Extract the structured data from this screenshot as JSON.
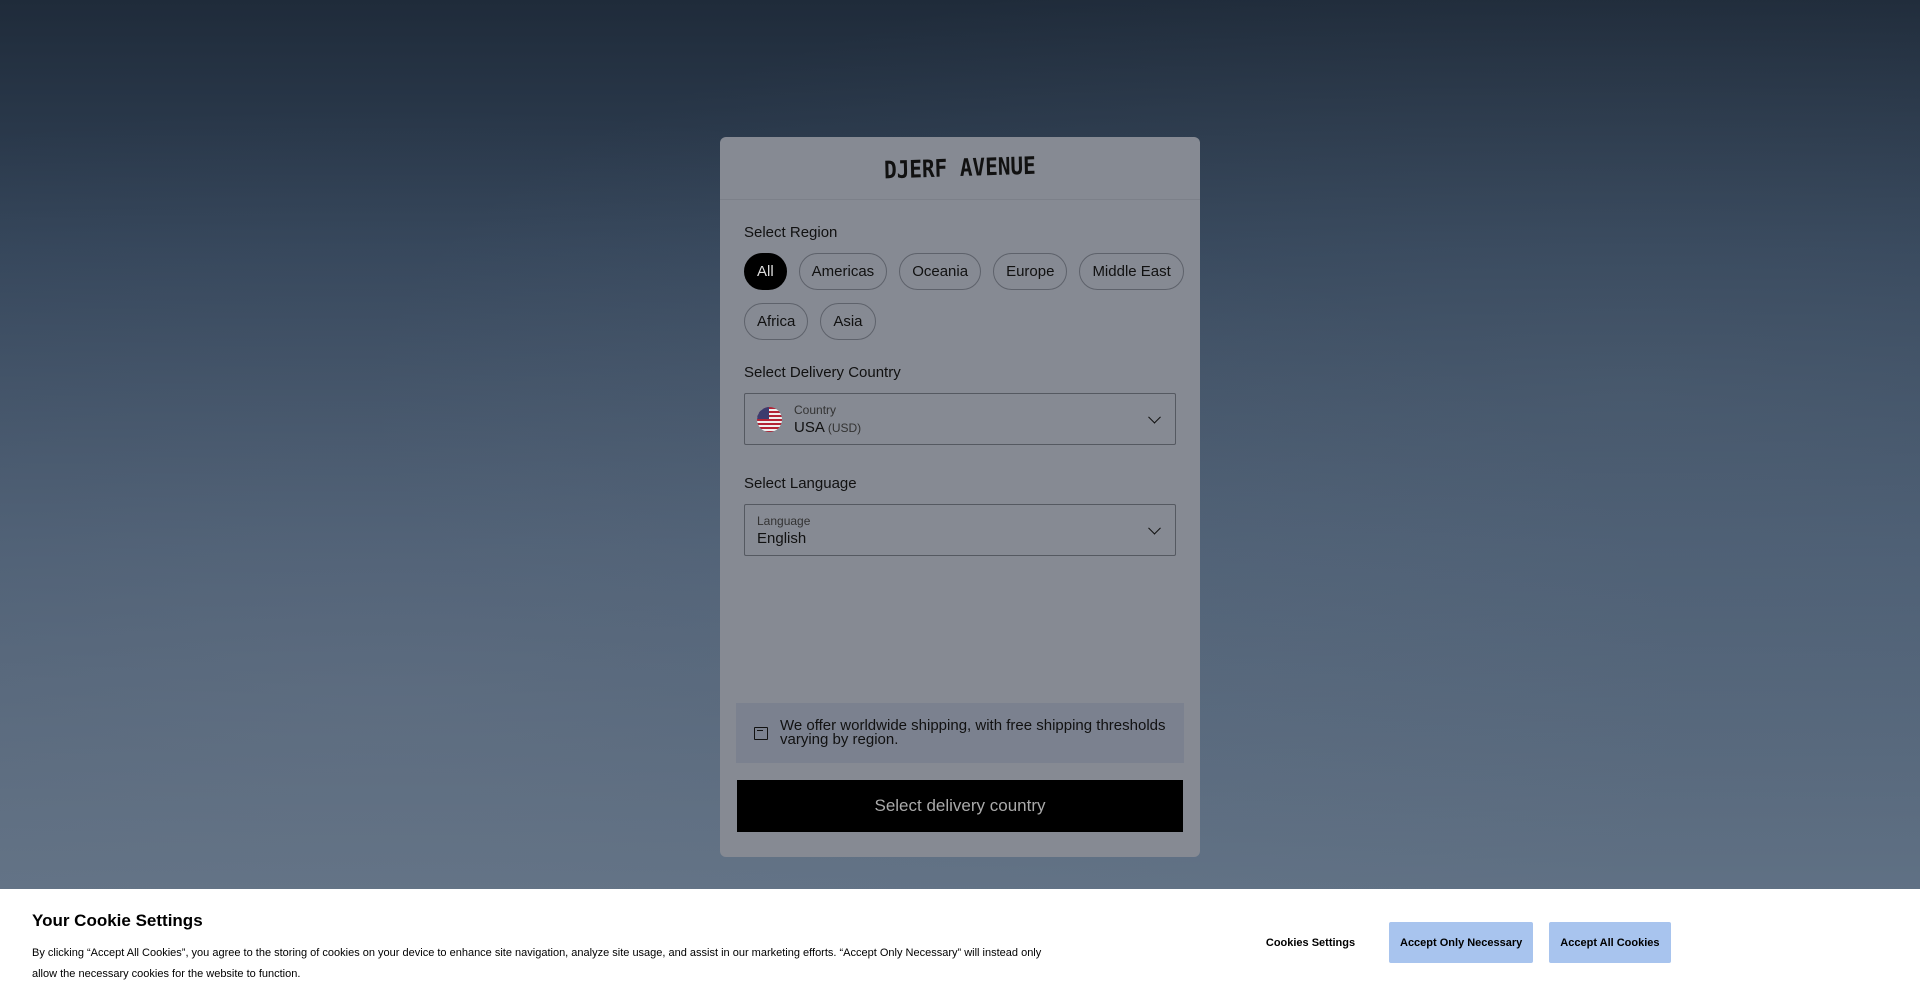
{
  "modal": {
    "logo": "DJERF AVENUE",
    "region_label": "Select Region",
    "regions": [
      "All",
      "Americas",
      "Oceania",
      "Europe",
      "Middle East",
      "Africa",
      "Asia"
    ],
    "active_region": "All",
    "country_label": "Select Delivery Country",
    "country": {
      "small_label": "Country",
      "value": "USA",
      "currency": "(USD)",
      "flag": "us-flag-icon"
    },
    "language_label": "Select Language",
    "language": {
      "small_label": "Language",
      "value": "English"
    },
    "info_text": "We offer worldwide shipping, with free shipping thresholds varying by region.",
    "cta_label": "Select delivery country"
  },
  "cookie": {
    "title": "Your Cookie Settings",
    "text": "By clicking “Accept All Cookies”, you agree to the storing of cookies on your device to enhance site navigation, analyze site usage, and assist in our marketing efforts. “Accept Only Necessary” will instead only allow the necessary cookies for the website to function.",
    "settings_label": "Cookies Settings",
    "necessary_label": "Accept Only Necessary",
    "accept_all_label": "Accept All Cookies"
  },
  "colors": {
    "accent_button": "#a8c4ee",
    "cta_background": "#000000"
  }
}
